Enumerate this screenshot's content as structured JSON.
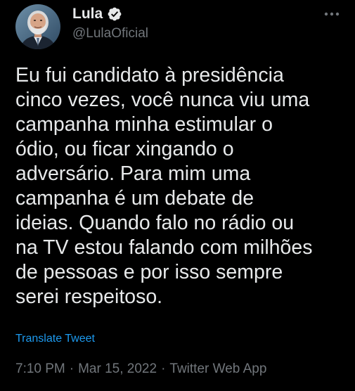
{
  "author": {
    "name": "Lula",
    "handle": "@LulaOficial",
    "verified": true,
    "avatar_icon": "avatar-photo"
  },
  "tweet": {
    "text": "Eu fui candidato à presidência\ncinco vezes, você nunca viu uma\ncampanha minha estimular o\nódio, ou ficar xingando o\nadversário. Para mim uma\ncampanha é um debate de\nideias. Quando falo no rádio ou\nna TV estou falando com milhões\nde pessoas e por isso sempre\nserei respeitoso.",
    "translate_label": "Translate Tweet",
    "time": "7:10 PM",
    "separator": "·",
    "date": "Mar 15, 2022",
    "source": "Twitter Web App"
  },
  "icons": {
    "more": "more-horizontal-icon",
    "verified": "verified-badge-icon"
  },
  "colors": {
    "background": "#000000",
    "text": "#e7e9ea",
    "secondary": "#71767b",
    "accent": "#1d9bf0"
  }
}
